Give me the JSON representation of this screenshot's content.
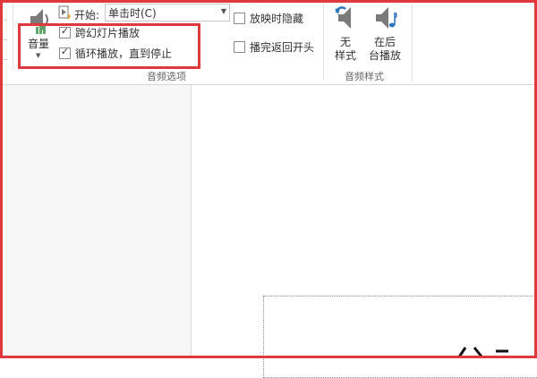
{
  "ribbon": {
    "volume": {
      "label": "音量",
      "icon": "speaker-volume-icon"
    },
    "audio_options": {
      "start_label": "开始:",
      "start_value": "单击时(C)",
      "hide_during_show": {
        "label": "放映时隐藏",
        "checked": false
      },
      "rewind_after_playing": {
        "label": "播完返回开头",
        "checked": false
      },
      "play_across_slides": {
        "label": "跨幻灯片播放",
        "checked": true
      },
      "loop_until_stopped": {
        "label": "循环播放，直到停止",
        "checked": true
      },
      "group_label": "音频选项"
    },
    "audio_styles": {
      "no_style": {
        "line1": "无",
        "line2": "样式",
        "icon": "speaker-undo-icon"
      },
      "play_in_background": {
        "line1": "在后",
        "line2": "台播放",
        "icon": "speaker-note-icon"
      },
      "group_label": "音频样式"
    }
  },
  "colors": {
    "highlight": "#e0393d",
    "icon_gray": "#7a7a7a",
    "icon_blue": "#2f76c0",
    "icon_green": "#5fa86a"
  },
  "check_glyph": "✓"
}
